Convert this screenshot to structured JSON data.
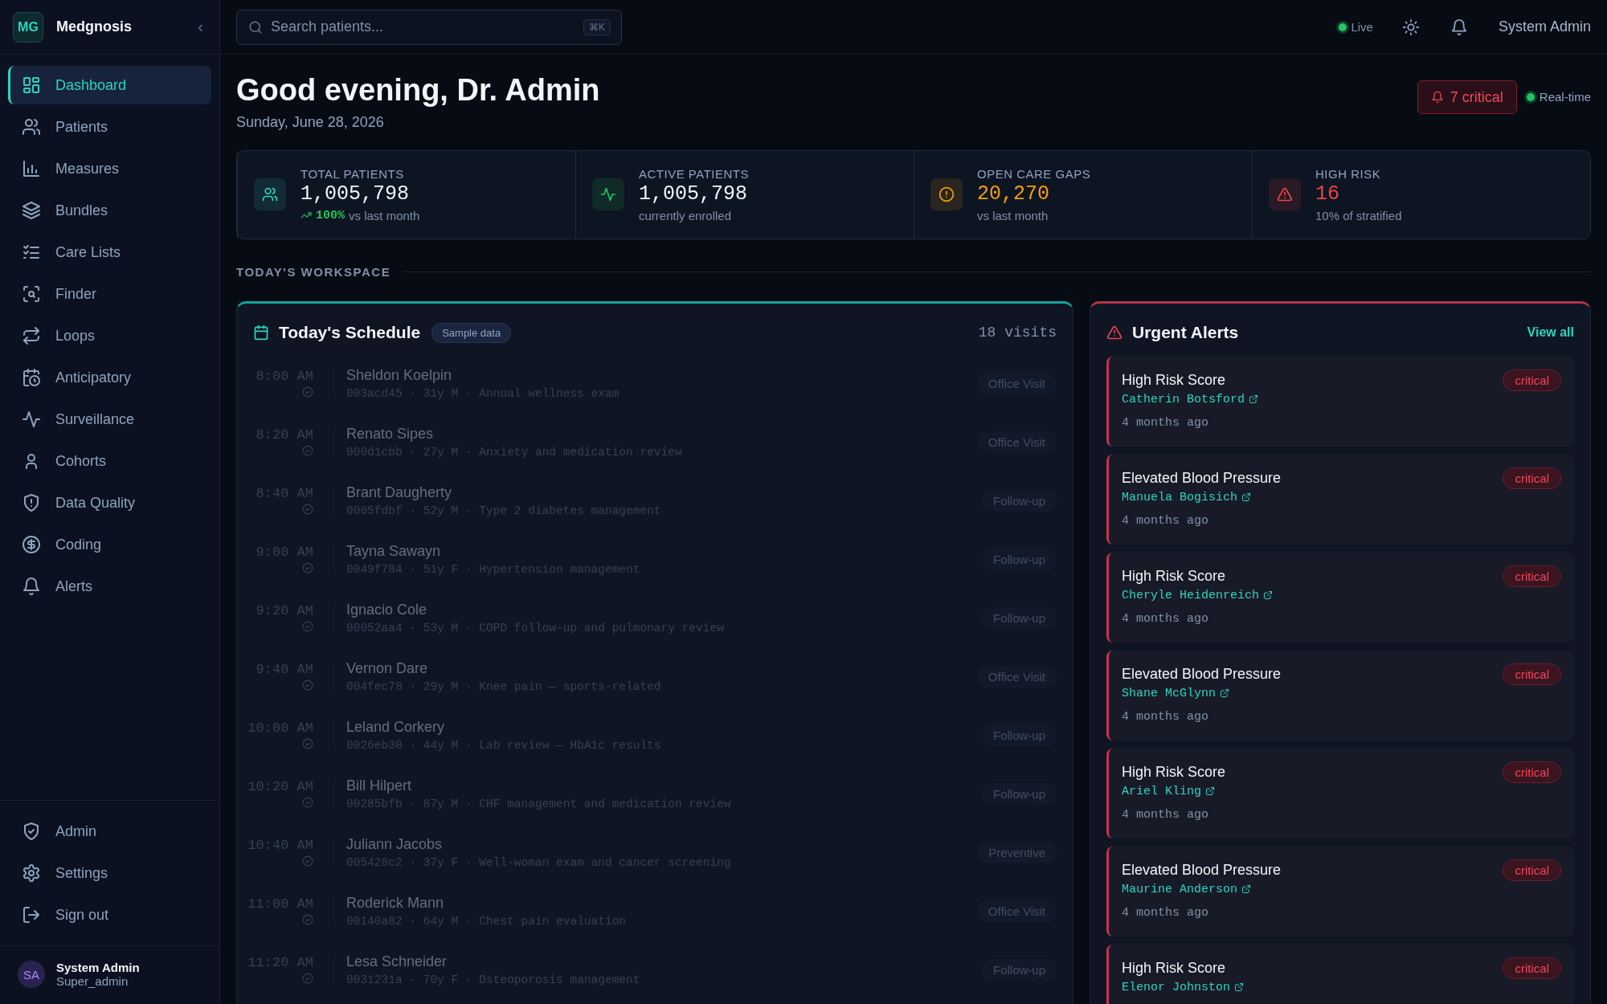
{
  "brand": {
    "logo": "MG",
    "name": "Medgnosis",
    "collapse": "‹"
  },
  "nav": [
    {
      "label": "Dashboard",
      "selected": true
    },
    {
      "label": "Patients",
      "selected": false
    },
    {
      "label": "Measures",
      "selected": false
    },
    {
      "label": "Bundles",
      "selected": false
    },
    {
      "label": "Care Lists",
      "selected": false
    },
    {
      "label": "Finder",
      "selected": false
    },
    {
      "label": "Loops",
      "selected": false
    },
    {
      "label": "Anticipatory",
      "selected": false
    },
    {
      "label": "Surveillance",
      "selected": false
    },
    {
      "label": "Cohorts",
      "selected": false
    },
    {
      "label": "Data Quality",
      "selected": false
    },
    {
      "label": "Coding",
      "selected": false
    },
    {
      "label": "Alerts",
      "selected": false
    }
  ],
  "nav_bottom": [
    {
      "label": "Admin"
    },
    {
      "label": "Settings"
    },
    {
      "label": "Sign out"
    }
  ],
  "user": {
    "initials": "SA",
    "name": "System Admin",
    "role": "Super_admin"
  },
  "topbar": {
    "search": {
      "placeholder": "Search patients...",
      "shortcut": "⌘K"
    },
    "live": "Live",
    "user": "System Admin"
  },
  "header": {
    "title": "Good evening, Dr. Admin",
    "date": "Sunday, June 28, 2026",
    "critical": "7 critical",
    "realtime": "Real-time"
  },
  "stats": [
    {
      "label": "TOTAL PATIENTS",
      "value": "1,005,798",
      "trend": "100%",
      "note": "vs last month",
      "color": "#2dd4bf",
      "value_colored": false
    },
    {
      "label": "ACTIVE PATIENTS",
      "value": "1,005,798",
      "note": "currently enrolled",
      "color": "#22c55e",
      "value_colored": false
    },
    {
      "label": "OPEN CARE GAPS",
      "value": "20,270",
      "note": "vs last month",
      "color": "#f59e0b",
      "value_colored": true
    },
    {
      "label": "HIGH RISK",
      "value": "16",
      "note": "10% of stratified",
      "color": "#ef4444",
      "value_colored": true
    }
  ],
  "workspace_label": "TODAY'S WORKSPACE",
  "schedule": {
    "title": "Today's Schedule",
    "badge": "Sample data",
    "count": "18 visits",
    "rows": [
      {
        "time": "8:00 AM",
        "name": "Sheldon Koelpin",
        "meta": "003acd45 · 31y M · Annual wellness exam",
        "type": "Office Visit",
        "completed": true
      },
      {
        "time": "8:20 AM",
        "name": "Renato Sipes",
        "meta": "000d1cbb · 27y M · Anxiety and medication review",
        "type": "Office Visit",
        "completed": true
      },
      {
        "time": "8:40 AM",
        "name": "Brant Daugherty",
        "meta": "0005fdbf · 52y M · Type 2 diabetes management",
        "type": "Follow-up",
        "completed": true
      },
      {
        "time": "9:00 AM",
        "name": "Tayna Sawayn",
        "meta": "0049f784 · 51y F · Hypertension management",
        "type": "Follow-up",
        "completed": true
      },
      {
        "time": "9:20 AM",
        "name": "Ignacio Cole",
        "meta": "00052aa4 · 53y M · COPD follow-up and pulmonary review",
        "type": "Follow-up",
        "completed": true
      },
      {
        "time": "9:40 AM",
        "name": "Vernon Dare",
        "meta": "004fec78 · 29y M · Knee pain — sports-related",
        "type": "Office Visit",
        "completed": true
      },
      {
        "time": "10:00 AM",
        "name": "Leland Corkery",
        "meta": "0026eb30 · 44y M · Lab review — HbA1c results",
        "type": "Follow-up",
        "completed": true
      },
      {
        "time": "10:20 AM",
        "name": "Bill Hilpert",
        "meta": "00285bfb · 87y M · CHF management and medication review",
        "type": "Follow-up",
        "completed": true
      },
      {
        "time": "10:40 AM",
        "name": "Juliann Jacobs",
        "meta": "005428c2 · 37y F · Well-woman exam and cancer screening",
        "type": "Preventive",
        "completed": true
      },
      {
        "time": "11:00 AM",
        "name": "Roderick Mann",
        "meta": "00140a82 · 64y M · Chest pain evaluation",
        "type": "Office Visit",
        "completed": true
      },
      {
        "time": "11:20 AM",
        "name": "Lesa Schneider",
        "meta": "0031231a · 70y F · Osteoporosis management",
        "type": "Follow-up",
        "completed": true
      }
    ]
  },
  "alerts": {
    "title": "Urgent Alerts",
    "view_all": "View all",
    "items": [
      {
        "title": "High Risk Score",
        "patient": "Catherin Botsford",
        "time": "4 months ago",
        "severity": "critical"
      },
      {
        "title": "Elevated Blood Pressure",
        "patient": "Manuela Bogisich",
        "time": "4 months ago",
        "severity": "critical"
      },
      {
        "title": "High Risk Score",
        "patient": "Cheryle Heidenreich",
        "time": "4 months ago",
        "severity": "critical"
      },
      {
        "title": "Elevated Blood Pressure",
        "patient": "Shane McGlynn",
        "time": "4 months ago",
        "severity": "critical"
      },
      {
        "title": "High Risk Score",
        "patient": "Ariel Kling",
        "time": "4 months ago",
        "severity": "critical"
      },
      {
        "title": "Elevated Blood Pressure",
        "patient": "Maurine Anderson",
        "time": "4 months ago",
        "severity": "critical"
      },
      {
        "title": "High Risk Score",
        "patient": "Elenor Johnston",
        "severity": "critical"
      }
    ]
  }
}
